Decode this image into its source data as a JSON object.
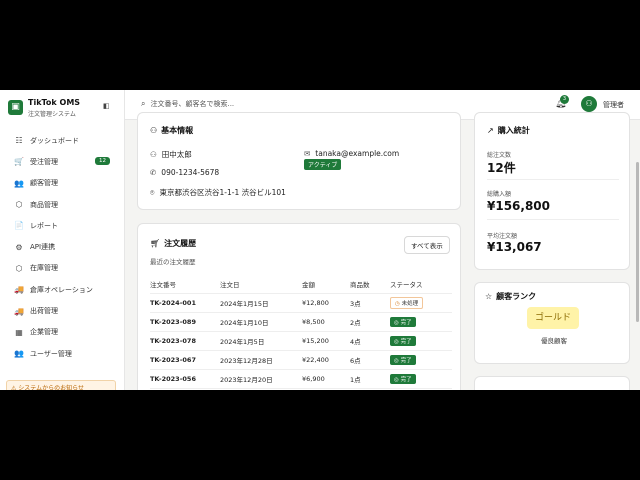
{
  "brand": {
    "logo_icon": "shopping-bag-icon",
    "name": "TikTok OMS",
    "subtitle": "注文管理システム"
  },
  "sidebar": {
    "items": [
      {
        "icon": "☷",
        "label": "ダッシュボード"
      },
      {
        "icon": "🛒",
        "label": "受注管理",
        "badge": "12"
      },
      {
        "icon": "👥",
        "label": "顧客管理"
      },
      {
        "icon": "⬡",
        "label": "商品管理"
      },
      {
        "icon": "📄",
        "label": "レポート"
      },
      {
        "icon": "⚙",
        "label": "API連携"
      },
      {
        "icon": "⬡",
        "label": "在庫管理"
      },
      {
        "icon": "🚚",
        "label": "倉庫オペレーション"
      },
      {
        "icon": "🚚",
        "label": "出荷管理"
      },
      {
        "icon": "▦",
        "label": "企業管理"
      },
      {
        "icon": "👥",
        "label": "ユーザー管理"
      }
    ],
    "alert": "⚠ システムからのお知らせ"
  },
  "topbar": {
    "search_placeholder": "注文番号、顧客名で検索...",
    "notification_count": "3",
    "avatar_icon": "user-icon",
    "user_name": "管理者"
  },
  "basic_info": {
    "title": "基本情報",
    "name": "田中太郎",
    "email": "tanaka@example.com",
    "phone": "090-1234-5678",
    "status": "アクティブ",
    "address": "東京都渋谷区渋谷1-1-1 渋谷ビル101"
  },
  "order_history": {
    "title": "注文履歴",
    "subtitle": "最近の注文履歴",
    "view_all": "すべて表示",
    "columns": [
      "注文番号",
      "注文日",
      "金額",
      "商品数",
      "ステータス"
    ],
    "rows": [
      {
        "id": "TK-2024-001",
        "date": "2024年1月15日",
        "amount": "¥12,800",
        "items": "3点",
        "status": "未処理",
        "state": "pending"
      },
      {
        "id": "TK-2023-089",
        "date": "2024年1月10日",
        "amount": "¥8,500",
        "items": "2点",
        "status": "完了",
        "state": "done"
      },
      {
        "id": "TK-2023-078",
        "date": "2024年1月5日",
        "amount": "¥15,200",
        "items": "4点",
        "status": "完了",
        "state": "done"
      },
      {
        "id": "TK-2023-067",
        "date": "2023年12月28日",
        "amount": "¥22,400",
        "items": "6点",
        "status": "完了",
        "state": "done"
      },
      {
        "id": "TK-2023-056",
        "date": "2023年12月20日",
        "amount": "¥6,900",
        "items": "1点",
        "status": "完了",
        "state": "done"
      }
    ]
  },
  "purchase_stats": {
    "title": "購入統計",
    "total_orders_label": "総注文数",
    "total_orders": "12件",
    "total_amount_label": "総購入額",
    "total_amount": "¥156,800",
    "average_label": "平均注文額",
    "average": "¥13,067"
  },
  "customer_rank": {
    "title": "顧客ランク",
    "rank": "ゴールド",
    "rank_sub": "優良顧客"
  },
  "colors": {
    "accent": "#1f7a3a",
    "gold": "#fff3a8"
  }
}
